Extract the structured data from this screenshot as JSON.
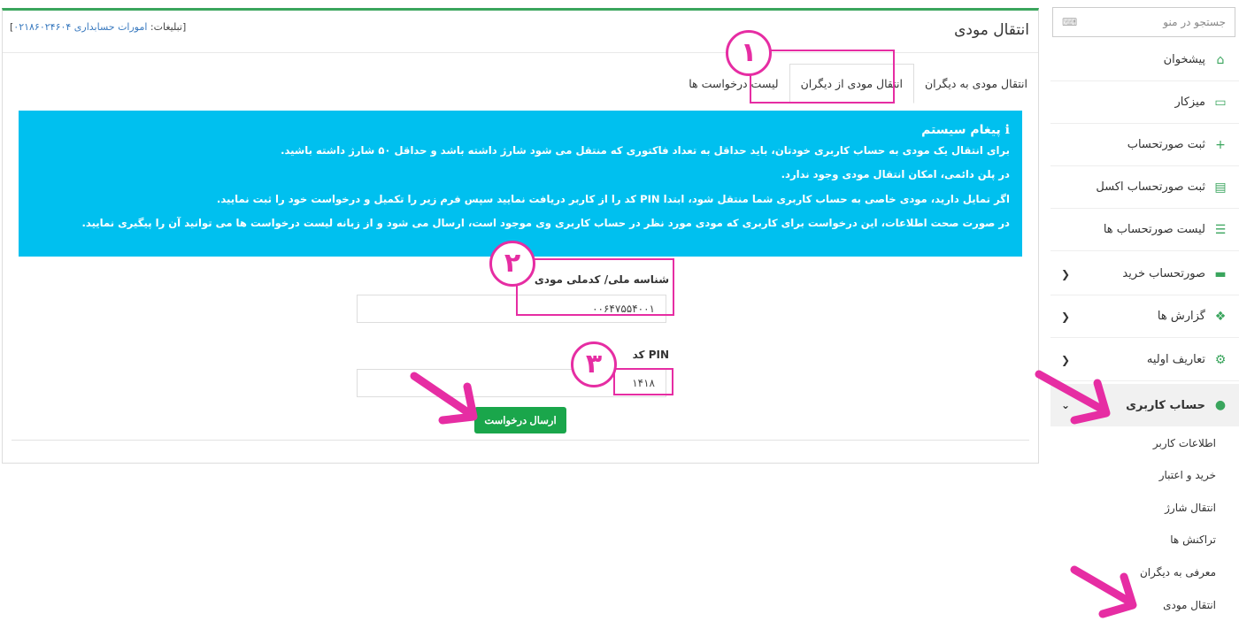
{
  "header": {
    "title": "انتقال مودی",
    "ad_label": "[تبلیغات: ",
    "ad_value": "امورات حسابداری ۰۲۱۸۶۰۲۴۶۰۴",
    "ad_close": "]"
  },
  "tabs": [
    {
      "label": "انتقال مودی به دیگران"
    },
    {
      "label": "انتقال مودی از دیگران"
    },
    {
      "label": "لیست درخواست ها"
    }
  ],
  "alert": {
    "title": "پیغام سیستم",
    "lines": [
      "برای انتقال یک مودی به حساب کاربری خودتان، باید حداقل به تعداد فاکتوری که منتقل می شود شارژ داشته باشد و حداقل ۵۰ شارژ داشته باشید.",
      "در پلن دائمی، امکان انتقال مودی وجود ندارد.",
      "اگر تمایل دارید، مودی خاصی به حساب کاربری شما منتقل شود، ابتدا PIN کد را از کاربر دریافت نمایید سپس فرم زیر را تکمیل و درخواست خود را ثبت نمایید.",
      "در صورت صحت اطلاعات، این درخواست برای کاربری که مودی مورد نظر در حساب کاربری وی موجود است، ارسال می شود و از زبانه لیست درخواست ها می توانید آن را پیگیری نمایید."
    ]
  },
  "form": {
    "national_id_label": "شناسه ملی/ کدملی مودی",
    "national_id_value": "۰۰۶۴۷۵۵۴۰۰۱",
    "pin_label": "PIN کد",
    "pin_value": "۱۴۱۸",
    "submit_label": "ارسال درخواست"
  },
  "annotations": {
    "step1": "۱",
    "step2": "۲",
    "step3": "۳"
  },
  "sidebar": {
    "search_placeholder": "جستجو در منو",
    "items": [
      {
        "label": "پیشخوان",
        "icon": "home-icon"
      },
      {
        "label": "میزکار",
        "icon": "monitor-icon"
      },
      {
        "label": "ثبت صورتحساب",
        "icon": "plus-icon"
      },
      {
        "label": "ثبت صورتحساب اکسل",
        "icon": "excel-icon"
      },
      {
        "label": "لیست صورتحساب ها",
        "icon": "list-icon"
      },
      {
        "label": "صورتحساب خرید",
        "icon": "money-icon"
      },
      {
        "label": "گزارش ها",
        "icon": "cubes-icon"
      },
      {
        "label": "تعاریف اولیه",
        "icon": "cogs-icon"
      },
      {
        "label": "حساب کاربری",
        "icon": "user-icon"
      }
    ],
    "subitems": [
      {
        "label": "اطلاعات کاربر"
      },
      {
        "label": "خرید و اعتبار"
      },
      {
        "label": "انتقال شارژ"
      },
      {
        "label": "تراکنش ها"
      },
      {
        "label": "معرفی به دیگران"
      },
      {
        "label": "انتقال مودی"
      }
    ]
  },
  "colors": {
    "accent": "#3aa55d",
    "alert": "#00c0ef",
    "annotation": "#e62da3",
    "button": "#1aa64b"
  }
}
